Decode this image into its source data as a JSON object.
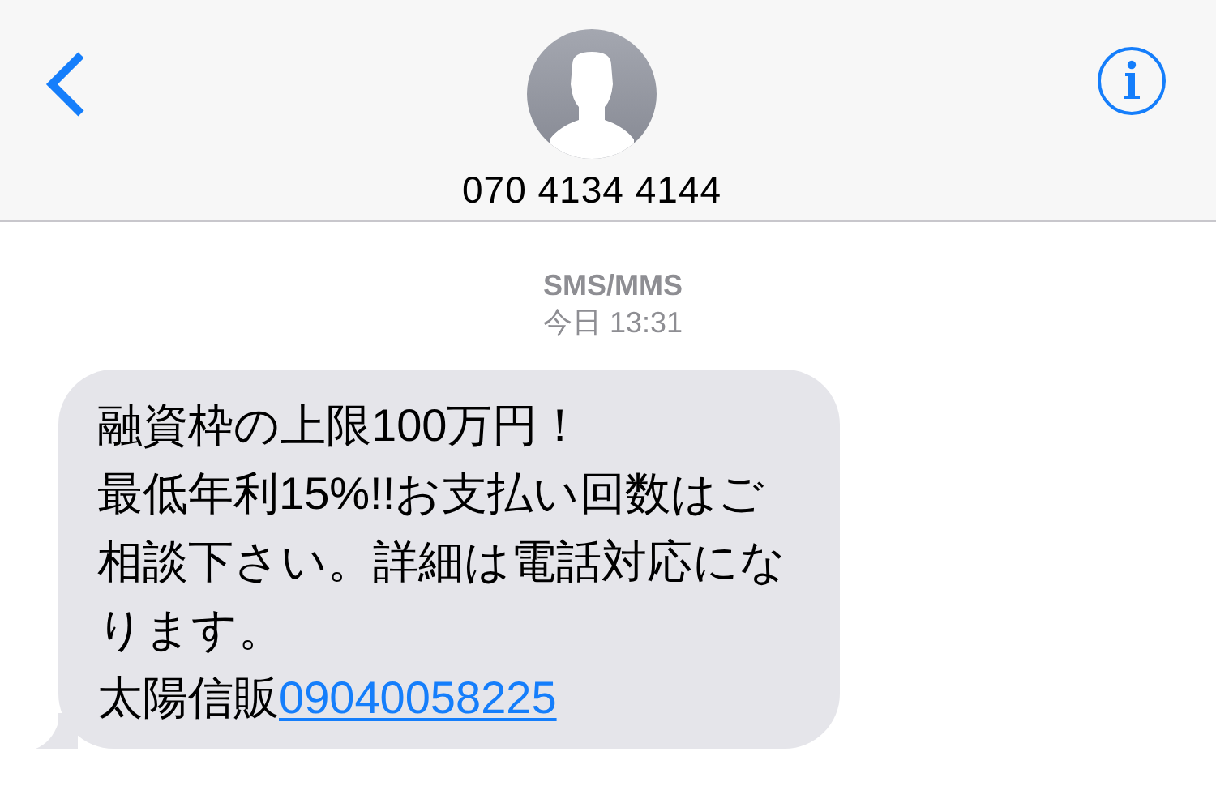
{
  "header": {
    "contact": "070 4134 4144"
  },
  "thread": {
    "service": "SMS/MMS",
    "time": "今日 13:31"
  },
  "messages": [
    {
      "kind": "incoming",
      "lines": [
        "融資枠の上限100万円！",
        "最低年利15%!!お支払い回数はご相談下さい。詳細は電話対応になります。",
        "太陽信販"
      ],
      "link": "09040058225"
    }
  ]
}
